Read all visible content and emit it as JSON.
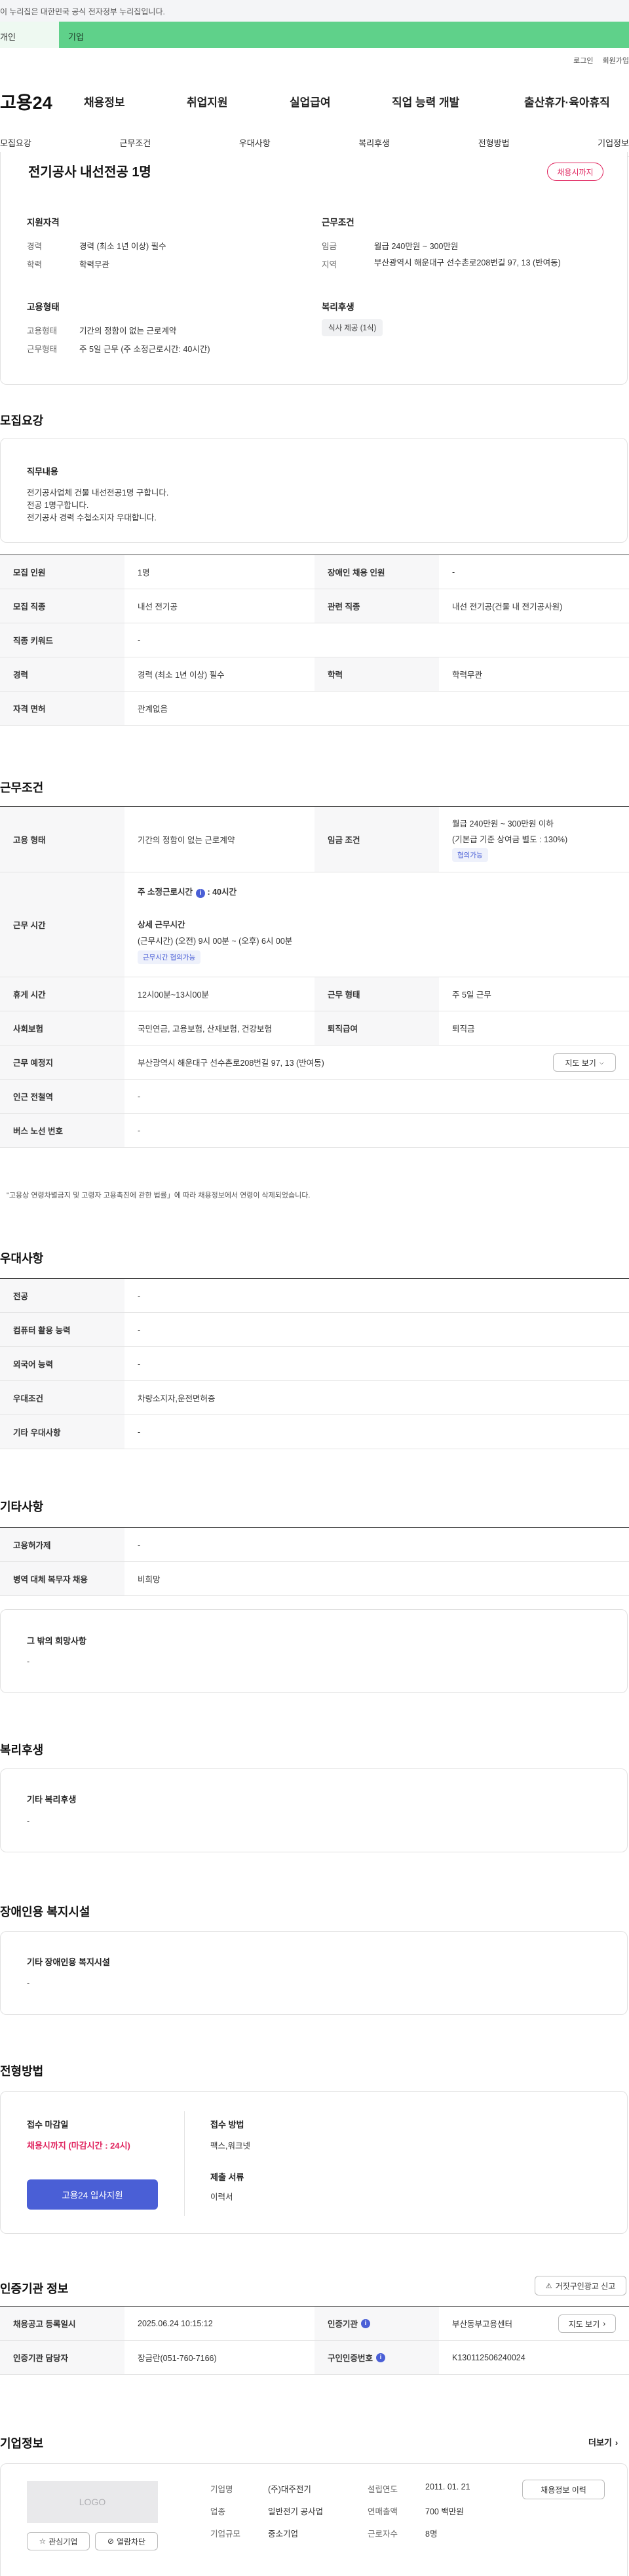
{
  "gov_banner": "이 누리집은 대한민국 공식 전자정부 누리집입니다.",
  "topbar": {
    "left": "개인",
    "right": "기업"
  },
  "util": {
    "login": "로그인",
    "signup": "회원가입"
  },
  "gnb": {
    "logo": "고용24",
    "menu": [
      "채용정보",
      "취업지원",
      "실업급여",
      "직업 능력 개발",
      "출산휴가·육아휴직"
    ]
  },
  "subnav": [
    "모집요강",
    "근무조건",
    "우대사항",
    "복리후생",
    "전형방법",
    "기업정보"
  ],
  "summary": {
    "title": "전기공사 내선전공 1명",
    "badge": "채용시까지",
    "qual_title": "지원자격",
    "qual": [
      {
        "k": "경력",
        "v": "경력 (최소 1년 이상) 필수"
      },
      {
        "k": "학력",
        "v": "학력무관"
      }
    ],
    "cond_title": "근무조건",
    "cond": [
      {
        "k": "임금",
        "v": "월급 240만원 ~ 300만원"
      },
      {
        "k": "지역",
        "v": "부산광역시 해운대구 선수촌로208번길 97, 13 (반여동)"
      }
    ],
    "emp_title": "고용형태",
    "emp": [
      {
        "k": "고용형태",
        "v": "기간의 정함이 없는 근로계약"
      },
      {
        "k": "근무형태",
        "v": "주 5일 근무 (주 소정근로시간: 40시간)"
      }
    ],
    "welfare_title": "복리후생",
    "welfare_tag": "식사 제공 (1식)"
  },
  "recruit": {
    "heading": "모집요강",
    "duty_title": "직무내용",
    "duty_lines": [
      "전기공사업체 건물 내선전공1명 구합니다.",
      "전공 1명구합니다.",
      "전기공사 경력 수첩소지자 우대합니다."
    ],
    "rows": [
      {
        "k1": "모집 인원",
        "v1": "1명",
        "k2": "장애인 채용 인원",
        "v2": "-"
      },
      {
        "k1": "모집 직종",
        "v1": "내선 전기공",
        "k2": "관련 직종",
        "v2": "내선 전기공(건물 내 전기공사원)"
      },
      {
        "k1": "직종 키워드",
        "v1": "-"
      },
      {
        "k1": "경력",
        "v1": "경력 (최소 1년 이상) 필수",
        "k2": "학력",
        "v2": "학력무관"
      },
      {
        "k1": "자격 면허",
        "v1": "관계없음"
      }
    ]
  },
  "work": {
    "heading": "근무조건",
    "emp_k": "고용 형태",
    "emp_v": "기간의 정함이 없는 근로계약",
    "wage_k": "임금 조건",
    "wage_v1": "월급 240만원 ~ 300만원 이하",
    "wage_v2": "(기본급 기준 상여금 별도 : 130%)",
    "wage_tag": "협의가능",
    "time_k": "근무 시간",
    "time_a": "주 소정근로시간",
    "time_a_v": ": 40시간",
    "time_b": "상세 근무시간",
    "time_b_v": "(근무시간) (오전) 9시 00분 ~ (오후) 6시 00분",
    "time_tag": "근무시간 협의가능",
    "rest_k": "휴게 시간",
    "rest_v": "12시00분~13시00분",
    "form_k": "근무 형태",
    "form_v": "주 5일 근무",
    "ins_k": "사회보험",
    "ins_v": "국민연금, 고용보험, 산재보험, 건강보험",
    "ret_k": "퇴직급여",
    "ret_v": "퇴직금",
    "loc_k": "근무 예정지",
    "loc_v": "부산광역시 해운대구 선수촌로208번길 97, 13 (반여동)",
    "map_btn": "지도 보기",
    "sub_k": "인근 전철역",
    "sub_v": "-",
    "bus_k": "버스 노선 번호",
    "bus_v": "-",
    "note": "\"고용상 연령차별금지 및 고령자 고용촉진에 관한 법률」에 따라 채용정보에서 연령이 삭제되었습니다."
  },
  "pref": {
    "heading": "우대사항",
    "rows": [
      {
        "k": "전공",
        "v": "-"
      },
      {
        "k": "컴퓨터 활용 능력",
        "v": "-"
      },
      {
        "k": "외국어 능력",
        "v": "-"
      },
      {
        "k": "우대조건",
        "v": "차량소지자,운전면허증"
      },
      {
        "k": "기타 우대사항",
        "v": "-"
      }
    ]
  },
  "etc": {
    "heading": "기타사항",
    "rows": [
      {
        "k": "고용허가제",
        "v": "-"
      },
      {
        "k": "병역 대체 복무자 채용",
        "v": "비희망"
      }
    ],
    "box_title": "그 밖의 희망사항",
    "box_val": "-"
  },
  "welfare": {
    "heading": "복리후생",
    "box_title": "기타 복리후생",
    "box_val": "-"
  },
  "disab": {
    "heading": "장애인용 복지시설",
    "box_title": "기타 장애인용 복지시설",
    "box_val": "-"
  },
  "process": {
    "heading": "전형방법",
    "deadline_k": "접수 마감일",
    "deadline_v": "채용시까지 (마감시간 : 24시)",
    "method_k": "접수 방법",
    "method_v": "팩스,워크넷",
    "docs_k": "제출 서류",
    "docs_v": "이력서",
    "apply_btn": "고용24 입사지원"
  },
  "cert": {
    "heading": "인증기관 정보",
    "report_btn": "거짓구인광고 신고",
    "r1k1": "채용공고 등록일시",
    "r1v1": "2025.06.24 10:15:12",
    "r1k2": "인증기관",
    "r1v2": "부산동부고용센터",
    "map_btn": "지도 보기",
    "r2k1": "인증기관 담당자",
    "r2v1": "장금란(051-760-7166)",
    "r2k2": "구인인증번호",
    "r2v2": "K130112506240024"
  },
  "company": {
    "heading": "기업정보",
    "more": "더보기",
    "logo_text": "LOGO",
    "fav": "관심기업",
    "block": "열람차단",
    "fields": [
      {
        "k": "기업명",
        "v": "(주)대주전기"
      },
      {
        "k": "업종",
        "v": "일반전기 공사업"
      },
      {
        "k": "기업규모",
        "v": "중소기업"
      }
    ],
    "fields2": [
      {
        "k": "설립연도",
        "v": "2011. 01. 21"
      },
      {
        "k": "연매출액",
        "v": "700 백만원"
      },
      {
        "k": "근로자수",
        "v": "8명"
      }
    ],
    "history_btn": "채용정보 이력"
  }
}
